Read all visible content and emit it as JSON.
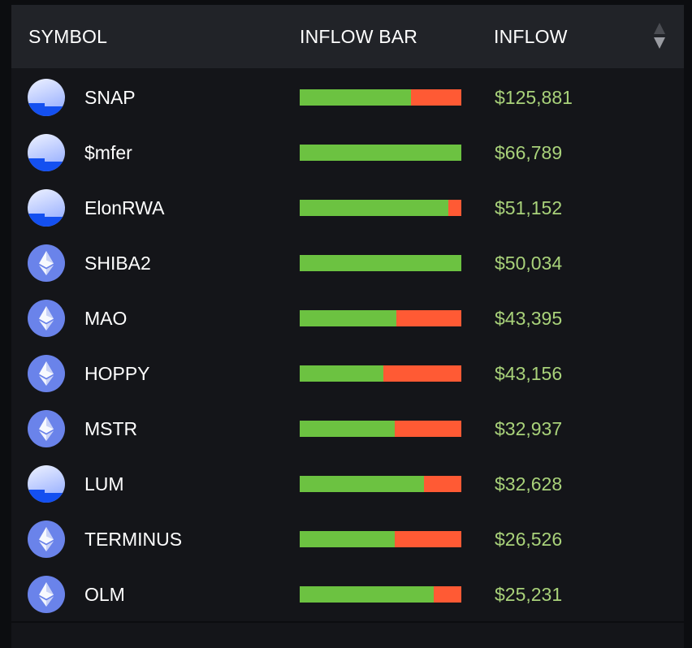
{
  "header": {
    "symbol": "SYMBOL",
    "inflow_bar": "INFLOW BAR",
    "inflow": "INFLOW"
  },
  "colors": {
    "inflow": "#6cc241",
    "outflow": "#ff5a34",
    "value_text": "#a9d27a"
  },
  "rows": [
    {
      "symbol": "SNAP",
      "icon": "snap",
      "inflow_fraction": 0.69,
      "inflow": "$125,881"
    },
    {
      "symbol": "$mfer",
      "icon": "snap",
      "inflow_fraction": 1.0,
      "inflow": "$66,789"
    },
    {
      "symbol": "ElonRWA",
      "icon": "snap",
      "inflow_fraction": 0.92,
      "inflow": "$51,152"
    },
    {
      "symbol": "SHIBA2",
      "icon": "eth",
      "inflow_fraction": 1.0,
      "inflow": "$50,034"
    },
    {
      "symbol": "MAO",
      "icon": "eth",
      "inflow_fraction": 0.6,
      "inflow": "$43,395"
    },
    {
      "symbol": "HOPPY",
      "icon": "eth",
      "inflow_fraction": 0.52,
      "inflow": "$43,156"
    },
    {
      "symbol": "MSTR",
      "icon": "eth",
      "inflow_fraction": 0.59,
      "inflow": "$32,937"
    },
    {
      "symbol": "LUM",
      "icon": "snap",
      "inflow_fraction": 0.77,
      "inflow": "$32,628"
    },
    {
      "symbol": "TERMINUS",
      "icon": "eth",
      "inflow_fraction": 0.59,
      "inflow": "$26,526"
    },
    {
      "symbol": "OLM",
      "icon": "eth",
      "inflow_fraction": 0.83,
      "inflow": "$25,231"
    }
  ]
}
